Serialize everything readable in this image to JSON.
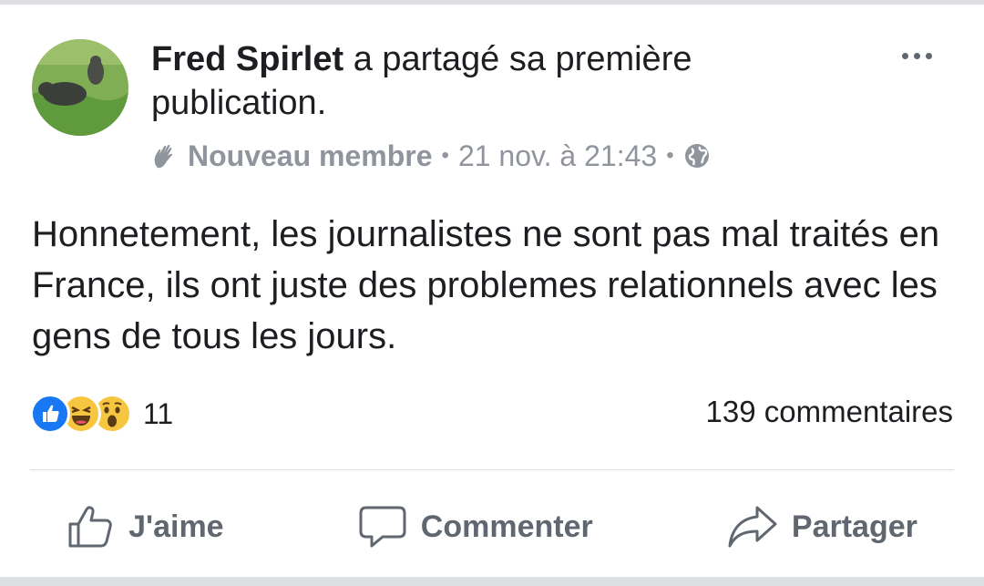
{
  "post": {
    "author": "Fred Spirlet",
    "action_text": " a partagé sa première publication.",
    "badge_label": "Nouveau membre",
    "separator": "•",
    "timestamp": "21 nov. à 21:43",
    "body": "Honnetement, les journalistes ne sont pas mal traités en France, ils ont juste des problemes relationnels avec les gens de tous les jours.",
    "badge_icon": "waving-hand-icon",
    "audience_icon": "globe-icon"
  },
  "reactions": {
    "types": [
      "like",
      "haha",
      "wow"
    ],
    "count": "11",
    "colors": {
      "like": "#1877f2",
      "emoji": "#f7c641"
    }
  },
  "comments": {
    "count_label": "139 commentaires"
  },
  "actions": {
    "like_label": "J'aime",
    "comment_label": "Commenter",
    "share_label": "Partager"
  }
}
